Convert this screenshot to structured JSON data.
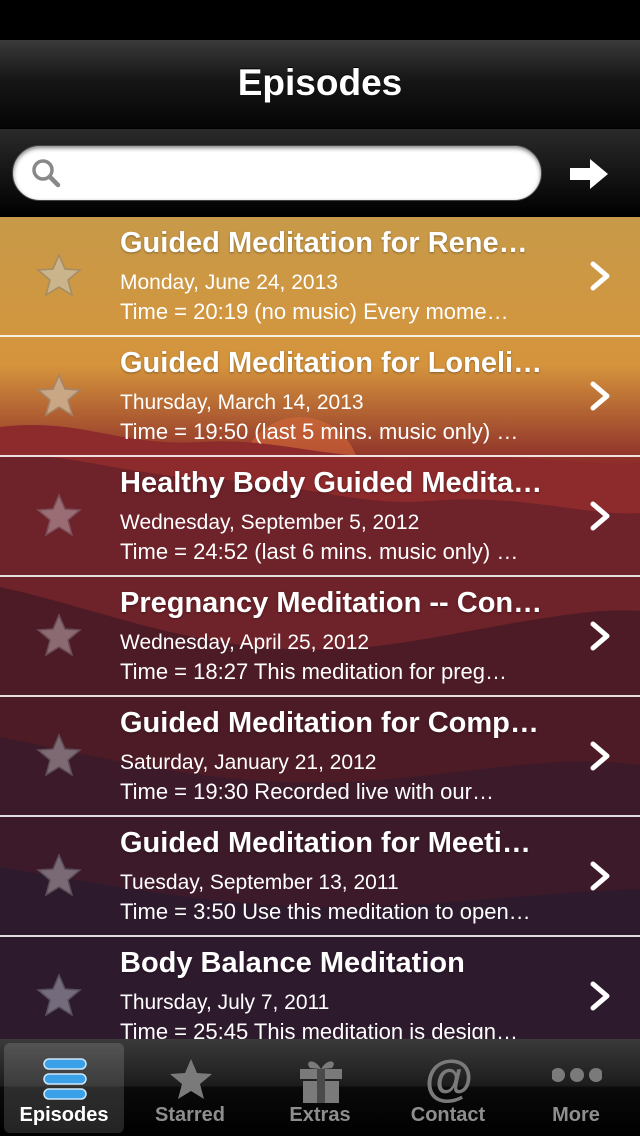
{
  "nav": {
    "title": "Episodes"
  },
  "search": {
    "value": "",
    "placeholder": ""
  },
  "episodes": [
    {
      "title": "Guided Meditation for Rene…",
      "date": "Monday, June 24, 2013",
      "description": "Time =  20:19 (no music)  Every mome…"
    },
    {
      "title": "Guided Meditation for Loneli…",
      "date": "Thursday, March 14, 2013",
      "description": "Time =  19:50 (last 5 mins. music only) …"
    },
    {
      "title": "Healthy Body Guided Medita…",
      "date": "Wednesday, September 5, 2012",
      "description": "Time =  24:52 (last 6 mins. music only) …"
    },
    {
      "title": "Pregnancy Meditation -- Con…",
      "date": "Wednesday, April 25, 2012",
      "description": "Time =  18:27  This meditation for preg…"
    },
    {
      "title": "Guided Meditation for Comp…",
      "date": "Saturday, January 21, 2012",
      "description": "Time =  19:30  Recorded live with our…"
    },
    {
      "title": "Guided Meditation for Meeti…",
      "date": "Tuesday, September 13, 2011",
      "description": "Time = 3:50 Use this meditation to open…"
    },
    {
      "title": "Body Balance Meditation",
      "date": "Thursday, July 7, 2011",
      "description": "Time = 25:45  This meditation is design…"
    }
  ],
  "tabs": [
    {
      "label": "Episodes",
      "icon": "episodes-list-icon",
      "active": true
    },
    {
      "label": "Starred",
      "icon": "star-icon",
      "active": false
    },
    {
      "label": "Extras",
      "icon": "gift-icon",
      "active": false
    },
    {
      "label": "Contact",
      "icon": "at-sign-icon",
      "active": false
    },
    {
      "label": "More",
      "icon": "more-dots-icon",
      "active": false
    }
  ],
  "colors": {
    "tab_active_icon": "#3aa0e8",
    "tab_inactive": "#8e8e8e",
    "star_fill": "#b9a383",
    "row_text": "#ffffff"
  }
}
